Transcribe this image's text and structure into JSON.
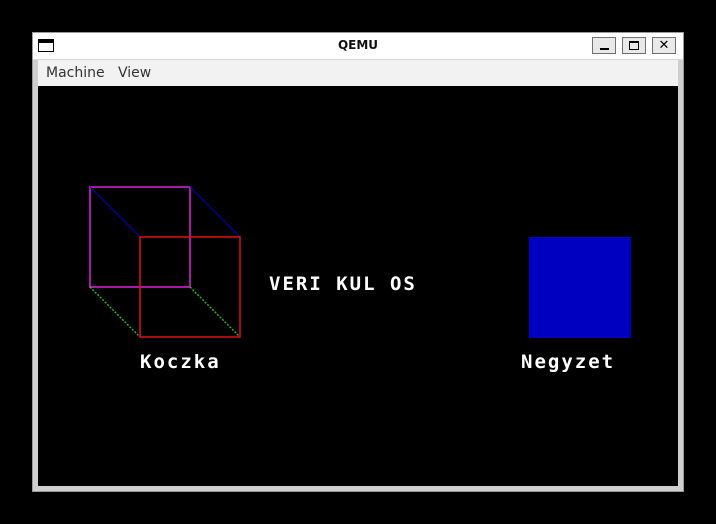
{
  "window": {
    "title": "QEMU",
    "close_glyph": "✕"
  },
  "menu": {
    "machine": "Machine",
    "view": "View"
  },
  "screen": {
    "center_text": "VERI KUL OS",
    "cube_label": "Koczka",
    "square_label": "Negyzet",
    "colors": {
      "background": "#000000",
      "cube_back": "#e020e0",
      "cube_front": "#e01010",
      "cube_edge_top": "#0000b0",
      "cube_edge_bottom": "#20c020",
      "square_fill": "#0000c0",
      "text": "#ffffff"
    }
  }
}
